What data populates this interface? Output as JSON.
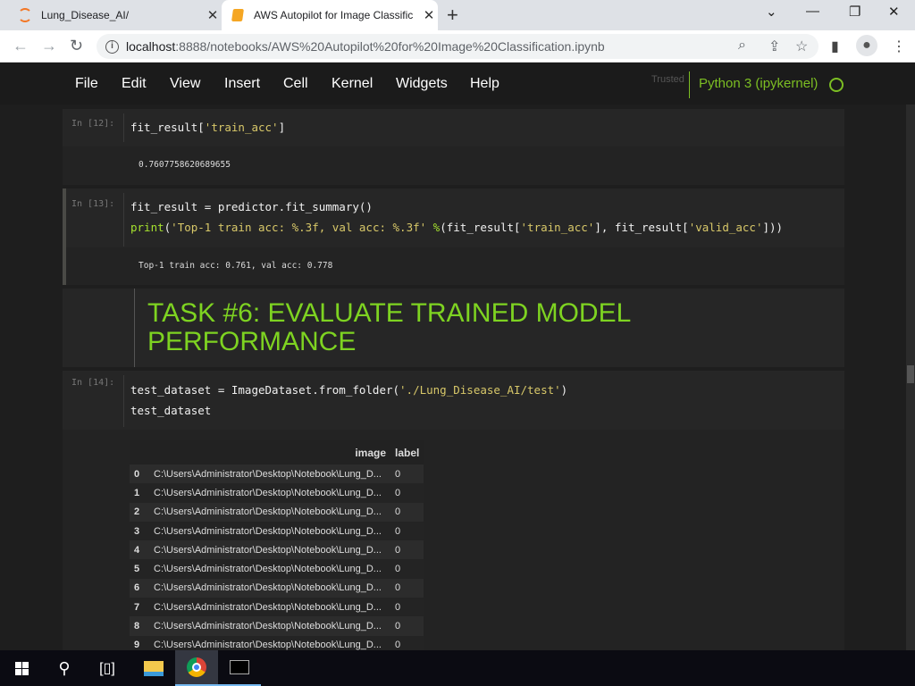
{
  "browser": {
    "tabs": [
      {
        "title": "Lung_Disease_AI/",
        "icon": "jupyter-icon"
      },
      {
        "title": "AWS Autopilot for Image Classific",
        "icon": "notebook-icon",
        "active": true
      }
    ],
    "url_host": "localhost",
    "url_rest": ":8888/notebooks/AWS%20Autopilot%20for%20Image%20Classification.ipynb"
  },
  "menu": {
    "items": [
      "File",
      "Edit",
      "View",
      "Insert",
      "Cell",
      "Kernel",
      "Widgets",
      "Help"
    ],
    "trusted": "Trusted",
    "kernel": "Python 3 (ipykernel)"
  },
  "colors": {
    "accent": "#7ed321",
    "kernel": "#7cbe23",
    "string": "#d8c869",
    "keyword": "#a6e22e"
  },
  "cells": [
    {
      "prompt": "In [12]:",
      "lines": [
        [
          {
            "t": "fit_result[",
            "c": "#f0f0f0"
          },
          {
            "t": "'train_acc'",
            "c": "#d8c869"
          },
          {
            "t": "]",
            "c": "#f0f0f0"
          }
        ]
      ],
      "output": "0.7607758620689655"
    },
    {
      "prompt": "In [13]:",
      "lines": [
        [
          {
            "t": "fit_result = predictor.fit_summary()",
            "c": "#f0f0f0"
          }
        ],
        [
          {
            "t": "print",
            "c": "#a6e22e"
          },
          {
            "t": "(",
            "c": "#f0f0f0"
          },
          {
            "t": "'Top-1 train acc: %.3f, val acc: %.3f'",
            "c": "#d8c869"
          },
          {
            "t": " %",
            "c": "#a6e22e"
          },
          {
            "t": "(fit_result[",
            "c": "#f0f0f0"
          },
          {
            "t": "'train_acc'",
            "c": "#d8c869"
          },
          {
            "t": "], fit_result[",
            "c": "#f0f0f0"
          },
          {
            "t": "'valid_acc'",
            "c": "#d8c869"
          },
          {
            "t": "]))",
            "c": "#f0f0f0"
          }
        ]
      ],
      "output": "Top-1 train acc: 0.761, val acc: 0.778"
    },
    {
      "heading": "TASK #6: EVALUATE TRAINED MODEL PERFORMANCE"
    },
    {
      "prompt": "In [14]:",
      "lines": [
        [
          {
            "t": "test_dataset = ImageDataset.from_folder(",
            "c": "#f0f0f0"
          },
          {
            "t": "'./Lung_Disease_AI/test'",
            "c": "#d8c869"
          },
          {
            "t": ")",
            "c": "#f0f0f0"
          }
        ],
        [
          {
            "t": "test_dataset",
            "c": "#f0f0f0"
          }
        ]
      ],
      "table": {
        "columns": [
          "",
          "image",
          "label"
        ],
        "rows": [
          [
            "0",
            "C:\\Users\\Administrator\\Desktop\\Notebook\\Lung_D...",
            "0"
          ],
          [
            "1",
            "C:\\Users\\Administrator\\Desktop\\Notebook\\Lung_D...",
            "0"
          ],
          [
            "2",
            "C:\\Users\\Administrator\\Desktop\\Notebook\\Lung_D...",
            "0"
          ],
          [
            "3",
            "C:\\Users\\Administrator\\Desktop\\Notebook\\Lung_D...",
            "0"
          ],
          [
            "4",
            "C:\\Users\\Administrator\\Desktop\\Notebook\\Lung_D...",
            "0"
          ],
          [
            "5",
            "C:\\Users\\Administrator\\Desktop\\Notebook\\Lung_D...",
            "0"
          ],
          [
            "6",
            "C:\\Users\\Administrator\\Desktop\\Notebook\\Lung_D...",
            "0"
          ],
          [
            "7",
            "C:\\Users\\Administrator\\Desktop\\Notebook\\Lung_D...",
            "0"
          ],
          [
            "8",
            "C:\\Users\\Administrator\\Desktop\\Notebook\\Lung_D...",
            "0"
          ],
          [
            "9",
            "C:\\Users\\Administrator\\Desktop\\Notebook\\Lung_D...",
            "0"
          ]
        ]
      }
    }
  ]
}
